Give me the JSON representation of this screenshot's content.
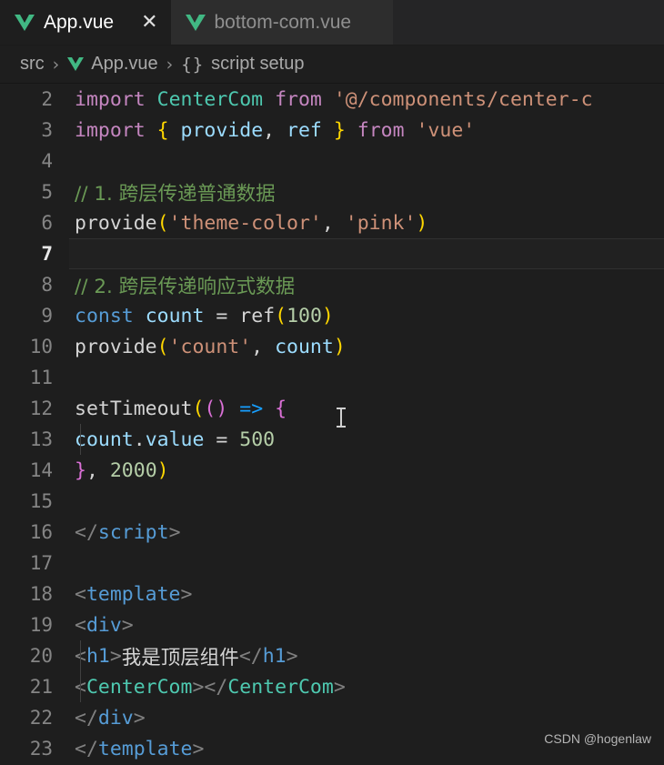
{
  "window": {
    "editor_background": "#1e1e1e",
    "tabbar_background": "#252526"
  },
  "tabs": [
    {
      "label": "App.vue",
      "icon": "vue-logo-icon",
      "active": true,
      "close_glyph": "✕"
    },
    {
      "label": "bottom-com.vue",
      "icon": "vue-logo-icon",
      "active": false
    }
  ],
  "breadcrumb": {
    "root": "src",
    "separator": "›",
    "file": "App.vue",
    "symbol_braces": "{}",
    "symbol": "script setup"
  },
  "code": {
    "lines": [
      {
        "n": "2",
        "guide": false,
        "active": false
      },
      {
        "n": "3",
        "guide": false,
        "active": false
      },
      {
        "n": "4",
        "guide": false,
        "active": false
      },
      {
        "n": "5",
        "guide": false,
        "active": false
      },
      {
        "n": "6",
        "guide": false,
        "active": false
      },
      {
        "n": "7",
        "guide": false,
        "active": true
      },
      {
        "n": "8",
        "guide": false,
        "active": false
      },
      {
        "n": "9",
        "guide": false,
        "active": false
      },
      {
        "n": "10",
        "guide": false,
        "active": false
      },
      {
        "n": "11",
        "guide": false,
        "active": false
      },
      {
        "n": "12",
        "guide": false,
        "active": false
      },
      {
        "n": "13",
        "guide": true,
        "active": false
      },
      {
        "n": "14",
        "guide": false,
        "active": false
      },
      {
        "n": "15",
        "guide": false,
        "active": false
      },
      {
        "n": "16",
        "guide": false,
        "active": false
      },
      {
        "n": "17",
        "guide": false,
        "active": false
      },
      {
        "n": "18",
        "guide": false,
        "active": false
      },
      {
        "n": "19",
        "guide": false,
        "active": false
      },
      {
        "n": "20",
        "guide": true,
        "active": false
      },
      {
        "n": "21",
        "guide": true,
        "active": false
      },
      {
        "n": "22",
        "guide": false,
        "active": false
      },
      {
        "n": "23",
        "guide": false,
        "active": false
      }
    ],
    "text": {
      "l2": {
        "kw_import": "import",
        "name": "CenterCom",
        "kw_from": "from",
        "str": "'@/components/center-c"
      },
      "l3": {
        "kw_import": "import",
        "brace_open": "{",
        "a": "provide",
        "comma": ",",
        "b": "ref",
        "brace_close": "}",
        "kw_from": "from",
        "str": "'vue'"
      },
      "l5": {
        "comment": "// 1. 跨层传递普通数据"
      },
      "l6": {
        "fn": "provide",
        "p_open": "(",
        "s1": "'theme-color'",
        "comma": ",",
        "s2": "'pink'",
        "p_close": ")"
      },
      "l8": {
        "comment": "// 2. 跨层传递响应式数据"
      },
      "l9": {
        "kw_const": "const",
        "var": "count",
        "eq": "=",
        "fn": "ref",
        "p_open": "(",
        "num": "100",
        "p_close": ")"
      },
      "l10": {
        "fn": "provide",
        "p_open": "(",
        "s1": "'count'",
        "comma": ",",
        "var": "count",
        "p_close": ")"
      },
      "l12": {
        "fn": "setTimeout",
        "p_open": "(",
        "p2_open": "(",
        "p2_close": ")",
        "arrow": "=>",
        "brace": "{"
      },
      "l13": {
        "var": "count",
        "dot": ".",
        "prop": "value",
        "eq": "=",
        "num": "500"
      },
      "l14": {
        "brace": "}",
        "comma": ",",
        "num": "2000",
        "p_close": ")"
      },
      "l16": {
        "br_open": "<",
        "slash": "/",
        "tag": "script",
        "br_close": ">"
      },
      "l18": {
        "br_open": "<",
        "tag": "template",
        "br_close": ">"
      },
      "l19": {
        "br_open": "<",
        "tag": "div",
        "br_close": ">"
      },
      "l20": {
        "o_open": "<",
        "o_tag": "h1",
        "o_close": ">",
        "han": "我是顶层组件",
        "c_open": "<",
        "c_slash": "/",
        "c_tag": "h1",
        "c_close": ">"
      },
      "l21": {
        "o_open": "<",
        "o_tag": "CenterCom",
        "o_close": ">",
        "c_open": "<",
        "c_slash": "/",
        "c_tag": "CenterCom",
        "c_close": ">"
      },
      "l22": {
        "br_open": "<",
        "slash": "/",
        "tag": "div",
        "br_close": ">"
      },
      "l23": {
        "br_open": "<",
        "slash": "/",
        "tag": "template",
        "br_close": ">"
      }
    }
  },
  "watermark": {
    "text": "CSDN @hogenlaw"
  }
}
